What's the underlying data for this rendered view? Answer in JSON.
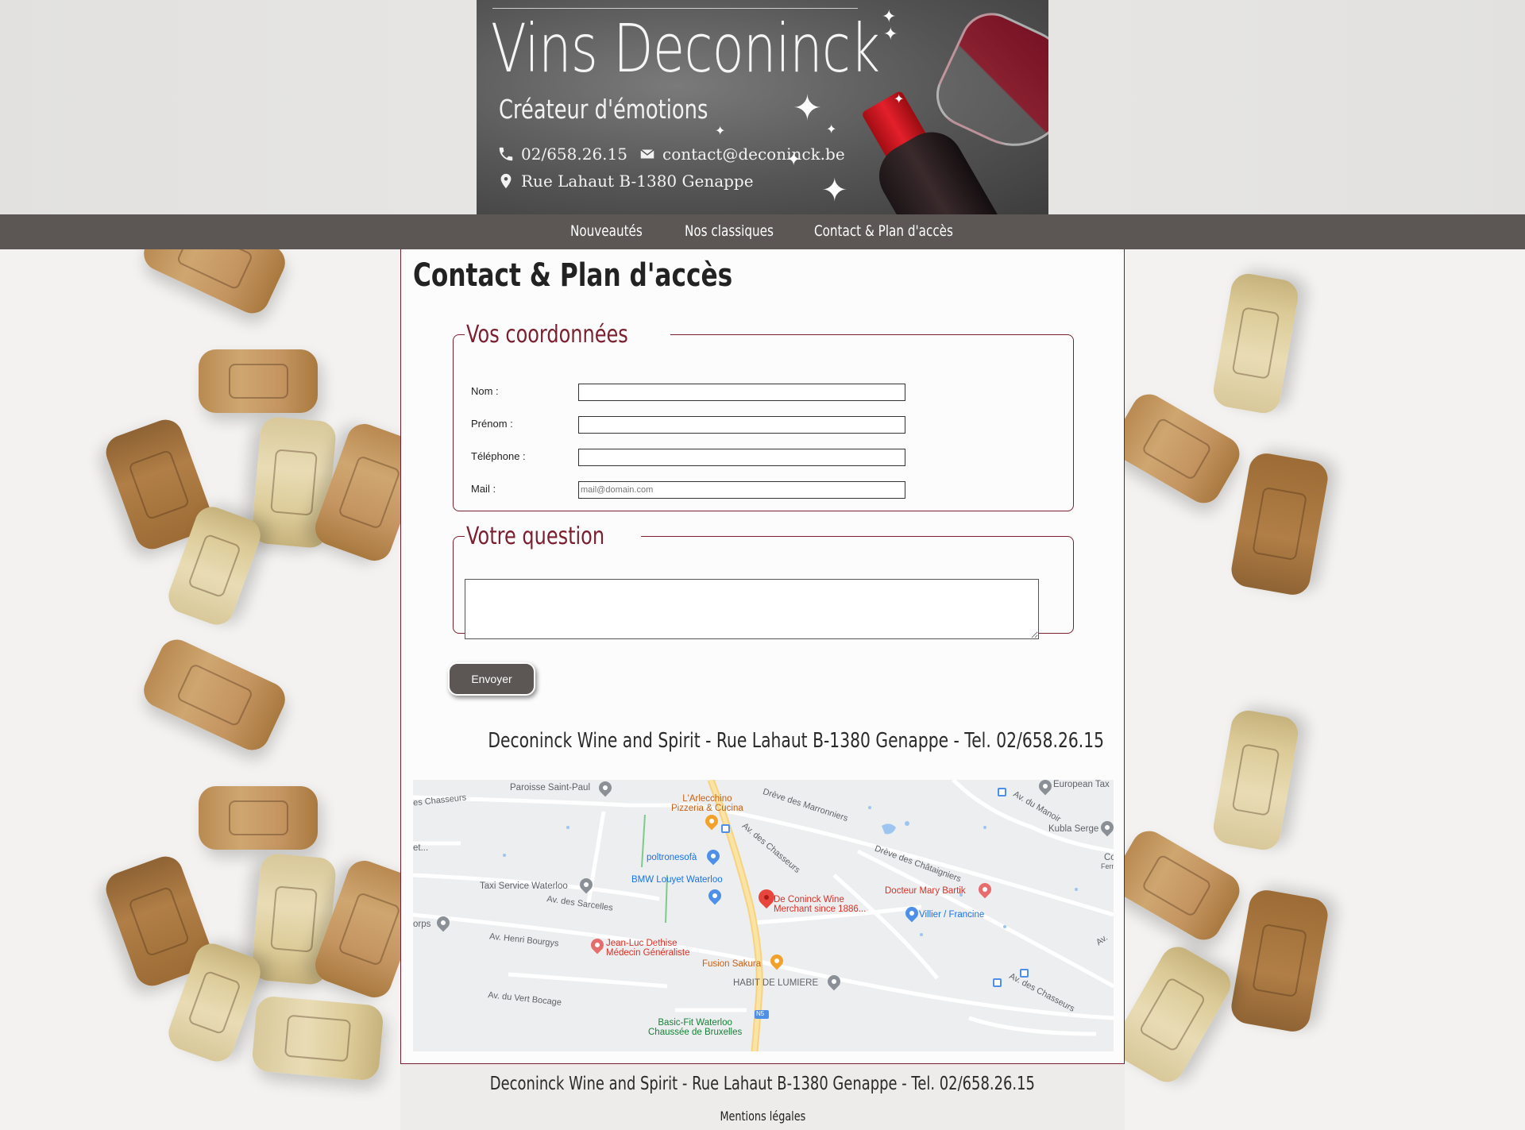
{
  "header": {
    "brand": "Vins Deconinck",
    "tagline": "Créateur d'émotions",
    "phone": "02/658.26.15",
    "email": "contact@deconinck.be",
    "address": "Rue Lahaut B-1380 Genappe"
  },
  "nav": {
    "items": [
      {
        "label": "Nouveautés"
      },
      {
        "label": "Nos classiques"
      },
      {
        "label": "Contact & Plan d'accès"
      }
    ]
  },
  "page": {
    "title": "Contact & Plan d'accès"
  },
  "form": {
    "coords_legend": "Vos coordonnées",
    "fields": [
      {
        "label": "Nom :",
        "value": "",
        "placeholder": ""
      },
      {
        "label": "Prénom :",
        "value": "",
        "placeholder": ""
      },
      {
        "label": "Téléphone :",
        "value": "",
        "placeholder": ""
      },
      {
        "label": "Mail :",
        "value": "",
        "placeholder": "mail@domain.com"
      }
    ],
    "question_legend": "Votre question",
    "question_value": "",
    "submit_label": "Envoyer"
  },
  "address_line": "Deconinck Wine and Spirit - Rue Lahaut B-1380 Genappe - Tel. 02/658.26.15",
  "map": {
    "labels": {
      "paroisse": "Paroisse Saint-Paul",
      "chasseurs_left": "es Chasseurs",
      "arlecchino": "L'Arlecchino\nPizzeria & Cucina",
      "marronniers": "Drève des Marronniers",
      "european": "European Tax",
      "manoir": "Av. du Manoir",
      "kubla": "Kubla Serge",
      "poltronesofa": "poltronesofà",
      "av_chasseurs_top": "Av. des Chasseurs",
      "chataigniers": "Drève des Châtaigniers",
      "bmw": "BMW Louyet Waterloo",
      "taxi": "Taxi Service Waterloo",
      "sarcelles": "Av. des Sarcelles",
      "deconinck": "De Coninck Wine\nMerchant since 1886...",
      "docteur": "Docteur Mary Bartik",
      "villier": "Villier / Francine",
      "orps": "orps",
      "henri": "Av. Henri Bourgys",
      "jeanluc": "Jean-Luc Dethise\nMédecin Généraliste",
      "fusion": "Fusion Sakura",
      "habit": "HABIT DE LUMIERE",
      "vert_bocage": "Av. du Vert Bocage",
      "basicfit": "Basic-Fit Waterloo\nChaussée de Bruxelles",
      "av_chasseurs_bottom": "Av. des Chasseurs",
      "av_right": "Av.",
      "et": "et...",
      "co": "Co",
      "ferm": "Ferm",
      "n5": "N5"
    }
  },
  "footer": {
    "address_line": "Deconinck Wine and Spirit - Rue Lahaut B-1380 Genappe - Tel. 02/658.26.15",
    "legal": "Mentions légales"
  },
  "colors": {
    "accent": "#7a1f2e",
    "nav_bg": "#5c5754",
    "button_bg": "#5c5754"
  }
}
